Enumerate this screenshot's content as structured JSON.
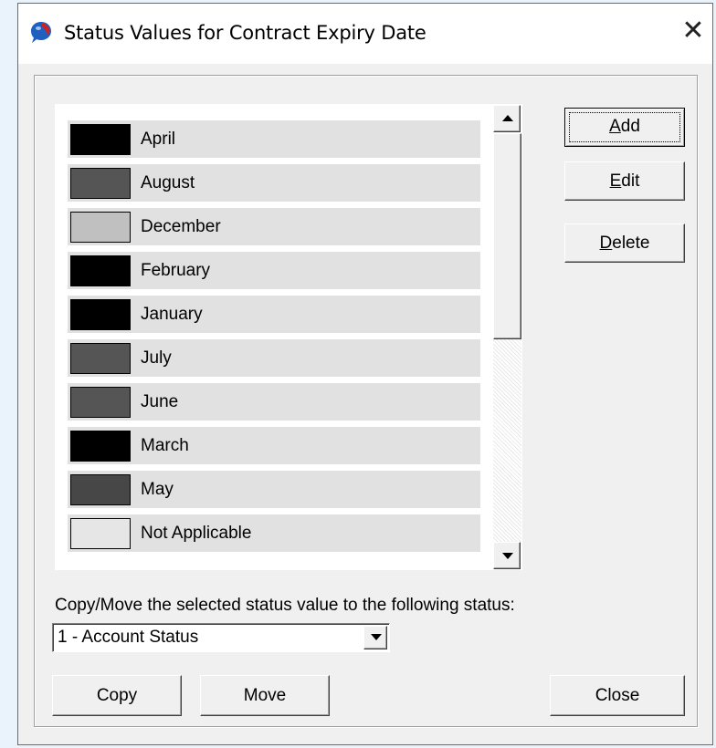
{
  "window": {
    "title": "Status Values for Contract Expiry Date",
    "close_glyph": "✕",
    "icon": "speech-bubble-icon"
  },
  "status_list": {
    "items": [
      {
        "label": "April",
        "color": "#000000"
      },
      {
        "label": "August",
        "color": "#555555"
      },
      {
        "label": "December",
        "color": "#c0c0c0"
      },
      {
        "label": "February",
        "color": "#000000"
      },
      {
        "label": "January",
        "color": "#000000"
      },
      {
        "label": "July",
        "color": "#555555"
      },
      {
        "label": "June",
        "color": "#555555"
      },
      {
        "label": "March",
        "color": "#000000"
      },
      {
        "label": "May",
        "color": "#474747"
      },
      {
        "label": "Not Applicable",
        "color": "#e6e6e6"
      }
    ]
  },
  "side_buttons": {
    "add": {
      "label": "Add",
      "mnemonic": "A",
      "rest": "dd"
    },
    "edit": {
      "label": "Edit",
      "mnemonic": "E",
      "rest": "dit"
    },
    "delete": {
      "label": "Delete",
      "mnemonic": "D",
      "rest": "elete"
    }
  },
  "copy_move": {
    "label": "Copy/Move the selected status value to the following status:",
    "selected_status": "1 - Account Status"
  },
  "bottom_buttons": {
    "copy": "Copy",
    "move": "Move",
    "close": "Close"
  }
}
